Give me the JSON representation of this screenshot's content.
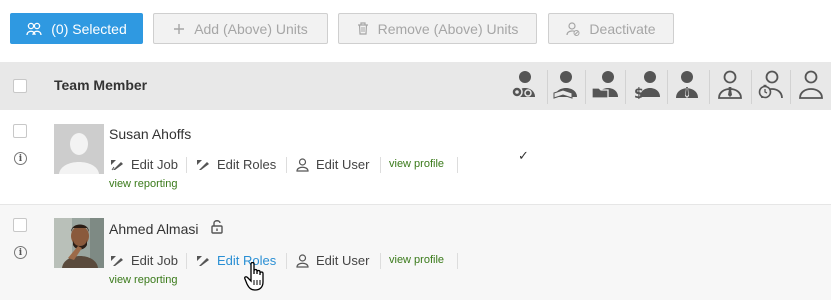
{
  "toolbar": {
    "selected_label": "(0) Selected",
    "add_label": "Add (Above) Units",
    "remove_label": "Remove (Above) Units",
    "deactivate_label": "Deactivate"
  },
  "header": {
    "title": "Team Member",
    "role_icons": [
      "user-gear-icon",
      "user-reading-icon",
      "user-folder-icon",
      "user-dollar-icon",
      "user-tie-icon",
      "user-badge-icon",
      "user-stopwatch-icon",
      "user-outline-icon"
    ]
  },
  "members": [
    {
      "name": "Susan Ahoffs",
      "edit_job": "Edit Job",
      "edit_roles": "Edit Roles",
      "edit_user": "Edit User",
      "view_profile": "view profile",
      "view_reporting": "view reporting",
      "check_mark": "✓"
    },
    {
      "name": "Ahmed Almasi",
      "edit_job": "Edit Job",
      "edit_roles": "Edit Roles",
      "edit_user": "Edit User",
      "view_profile": "view profile",
      "view_reporting": "view reporting"
    }
  ],
  "colors": {
    "primary": "#2f99e1",
    "link_green": "#3a7a1a",
    "link_blue": "#2a8fd4"
  }
}
